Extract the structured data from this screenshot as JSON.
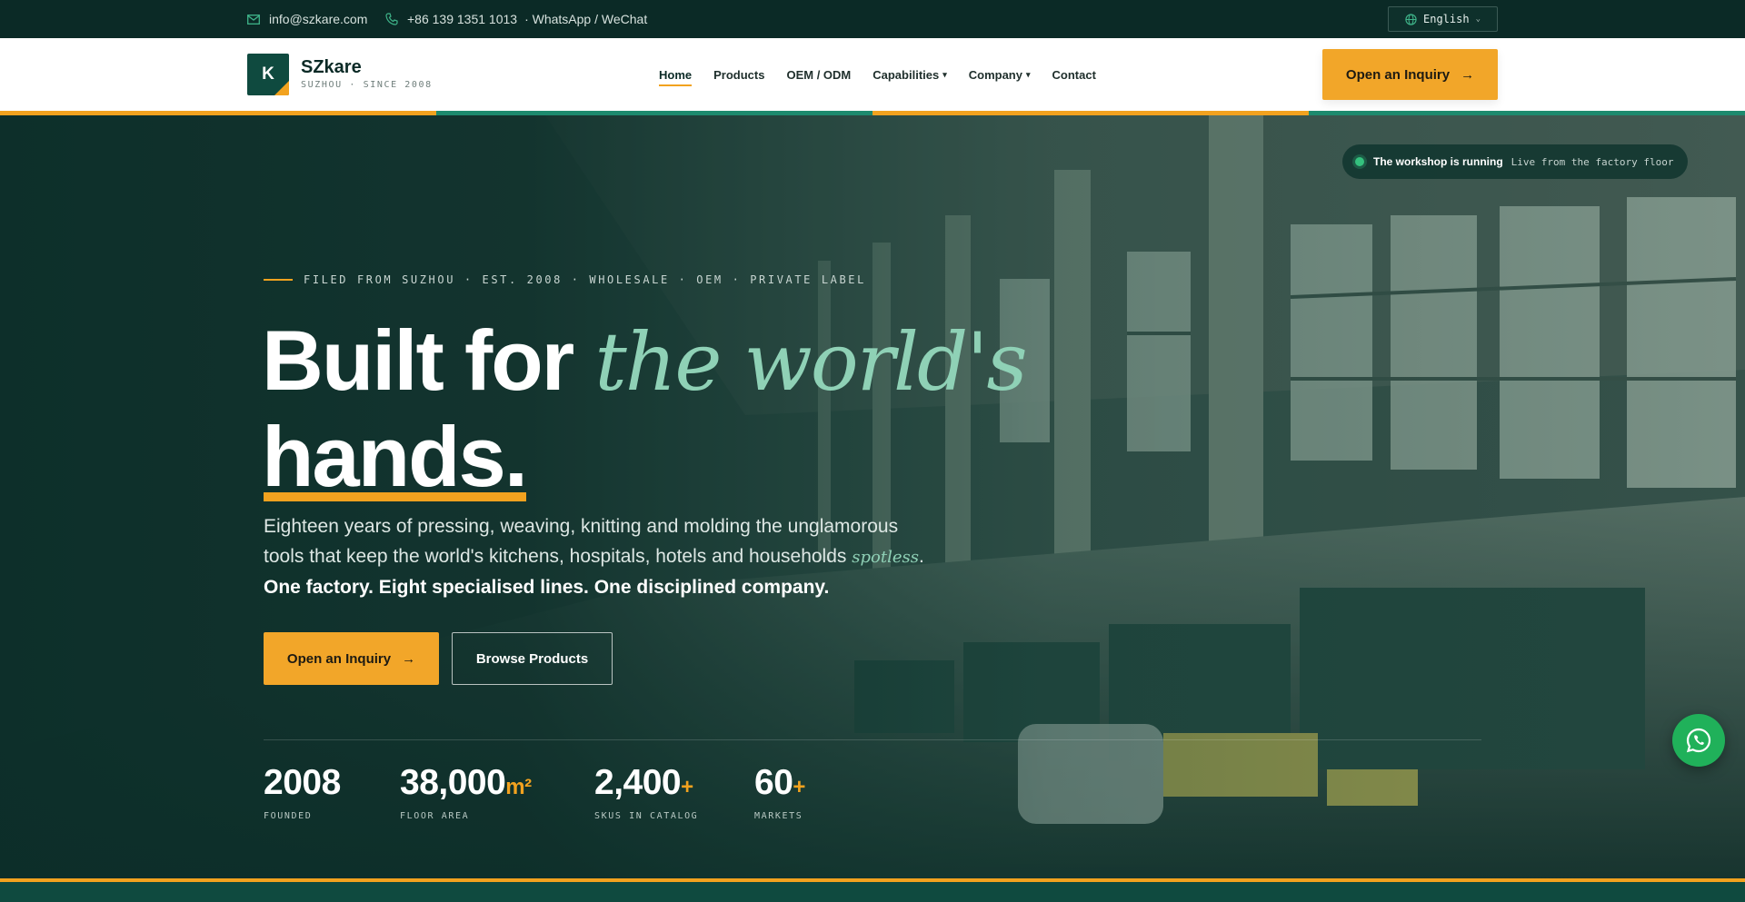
{
  "topbar": {
    "email": "info@szkare.com",
    "phone": "+86 139 1351 1013",
    "messaging": "· WhatsApp / WeChat",
    "language": "English"
  },
  "nav": {
    "logo_letter": "K",
    "brand": "SZkare",
    "brand_sub": "SUZHOU · SINCE 2008",
    "items": [
      {
        "label": "Home",
        "active": true
      },
      {
        "label": "Products"
      },
      {
        "label": "OEM / ODM"
      },
      {
        "label": "Capabilities",
        "caret": "▾"
      },
      {
        "label": "Company",
        "caret": "▾"
      },
      {
        "label": "Contact"
      }
    ],
    "cta": "Open an Inquiry",
    "cta_arrow": "→"
  },
  "hero": {
    "status_title": "The workshop is running",
    "status_sub": "Live from the factory floor",
    "eyebrow": "FILED FROM SUZHOU · EST. 2008 · WHOLESALE · OEM · PRIVATE LABEL",
    "headline_a": "Built for ",
    "headline_b": "the world's",
    "headline_c": "hands.",
    "lede_a": "Eighteen years of pressing, weaving, knitting and molding the unglamorous tools that keep the world's kitchens, hospitals, hotels and households ",
    "lede_italic": "spotless",
    "lede_b": ".",
    "lede_strong": "One factory. Eight specialised lines. One disciplined company.",
    "btn_primary": "Open an Inquiry",
    "btn_primary_arrow": "→",
    "btn_secondary": "Browse Products",
    "stats": [
      {
        "value": "2008",
        "suffix": "",
        "label": "FOUNDED"
      },
      {
        "value": "38,000",
        "suffix": "m²",
        "label": "FLOOR AREA"
      },
      {
        "value": "2,400",
        "suffix": "+",
        "label": "SKUS IN CATALOG"
      },
      {
        "value": "60",
        "suffix": "+",
        "label": "MARKETS"
      }
    ]
  },
  "colors": {
    "dark_green": "#0b2a26",
    "accent_amber": "#f2a629",
    "mint": "#8fd1b6",
    "whatsapp_green": "#20b15a"
  },
  "icons": {
    "email": "mail-icon",
    "phone": "phone-icon",
    "language": "globe-icon",
    "whatsapp": "whatsapp-icon"
  }
}
